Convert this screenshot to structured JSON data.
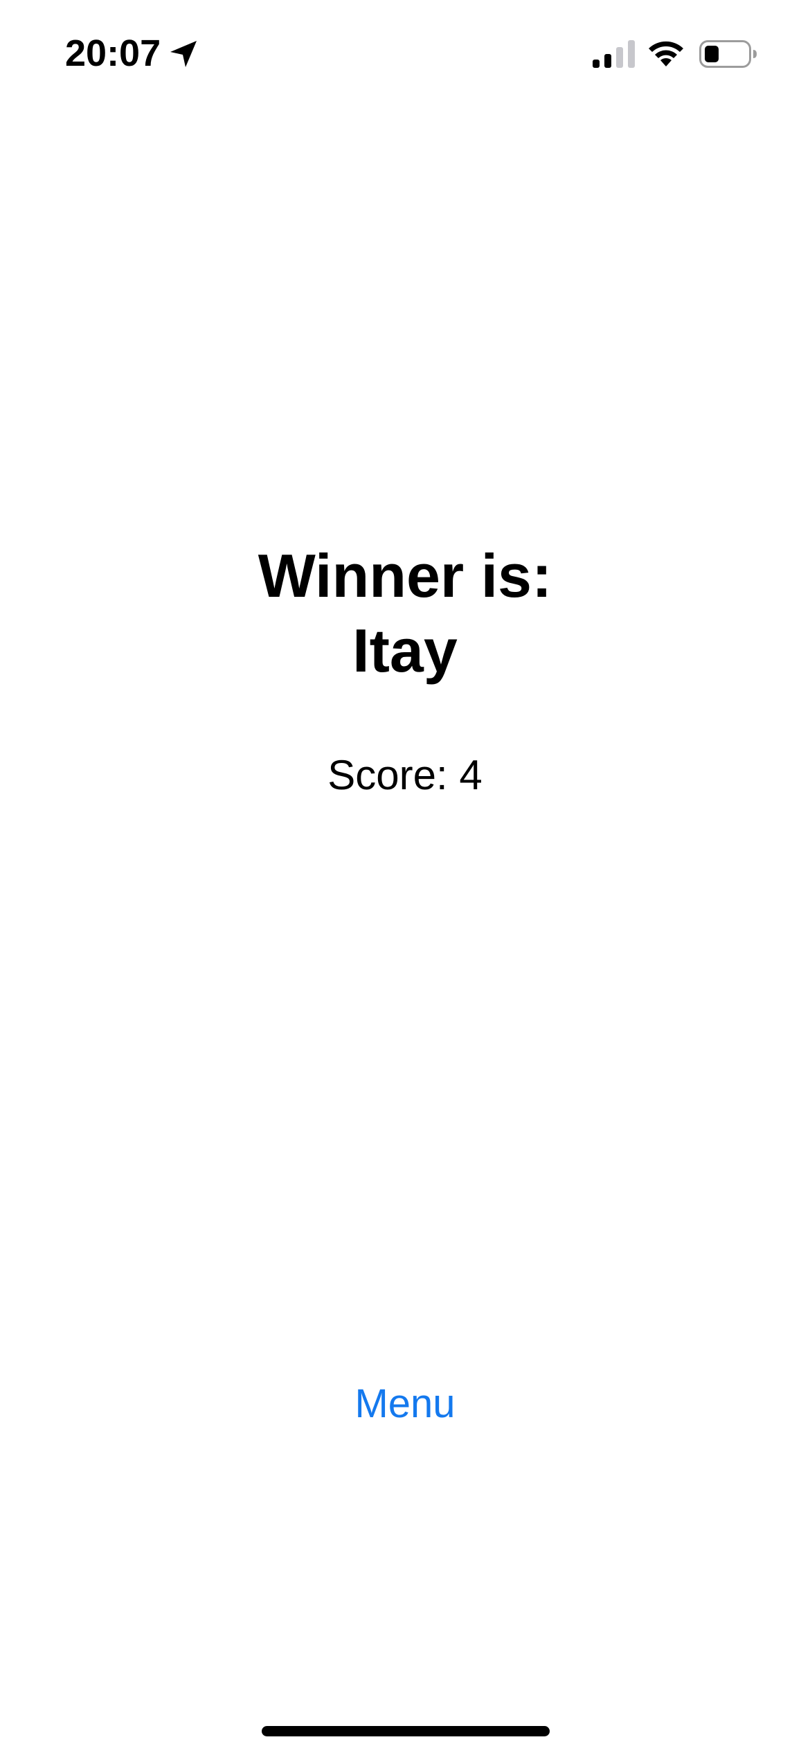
{
  "status_bar": {
    "time": "20:07",
    "icons": {
      "location": "location-arrow-icon",
      "signal": "cellular-signal-icon",
      "wifi": "wifi-icon",
      "battery": "battery-icon"
    },
    "signal_bars_active": 2,
    "signal_bars_total": 4,
    "battery_level": 0.3
  },
  "result": {
    "title_line1": "Winner is:",
    "winner_name": "Itay",
    "score_text": "Score: 4"
  },
  "actions": {
    "menu_label": "Menu"
  },
  "colors": {
    "accent": "#1479ee",
    "text": "#000000",
    "background": "#ffffff"
  }
}
